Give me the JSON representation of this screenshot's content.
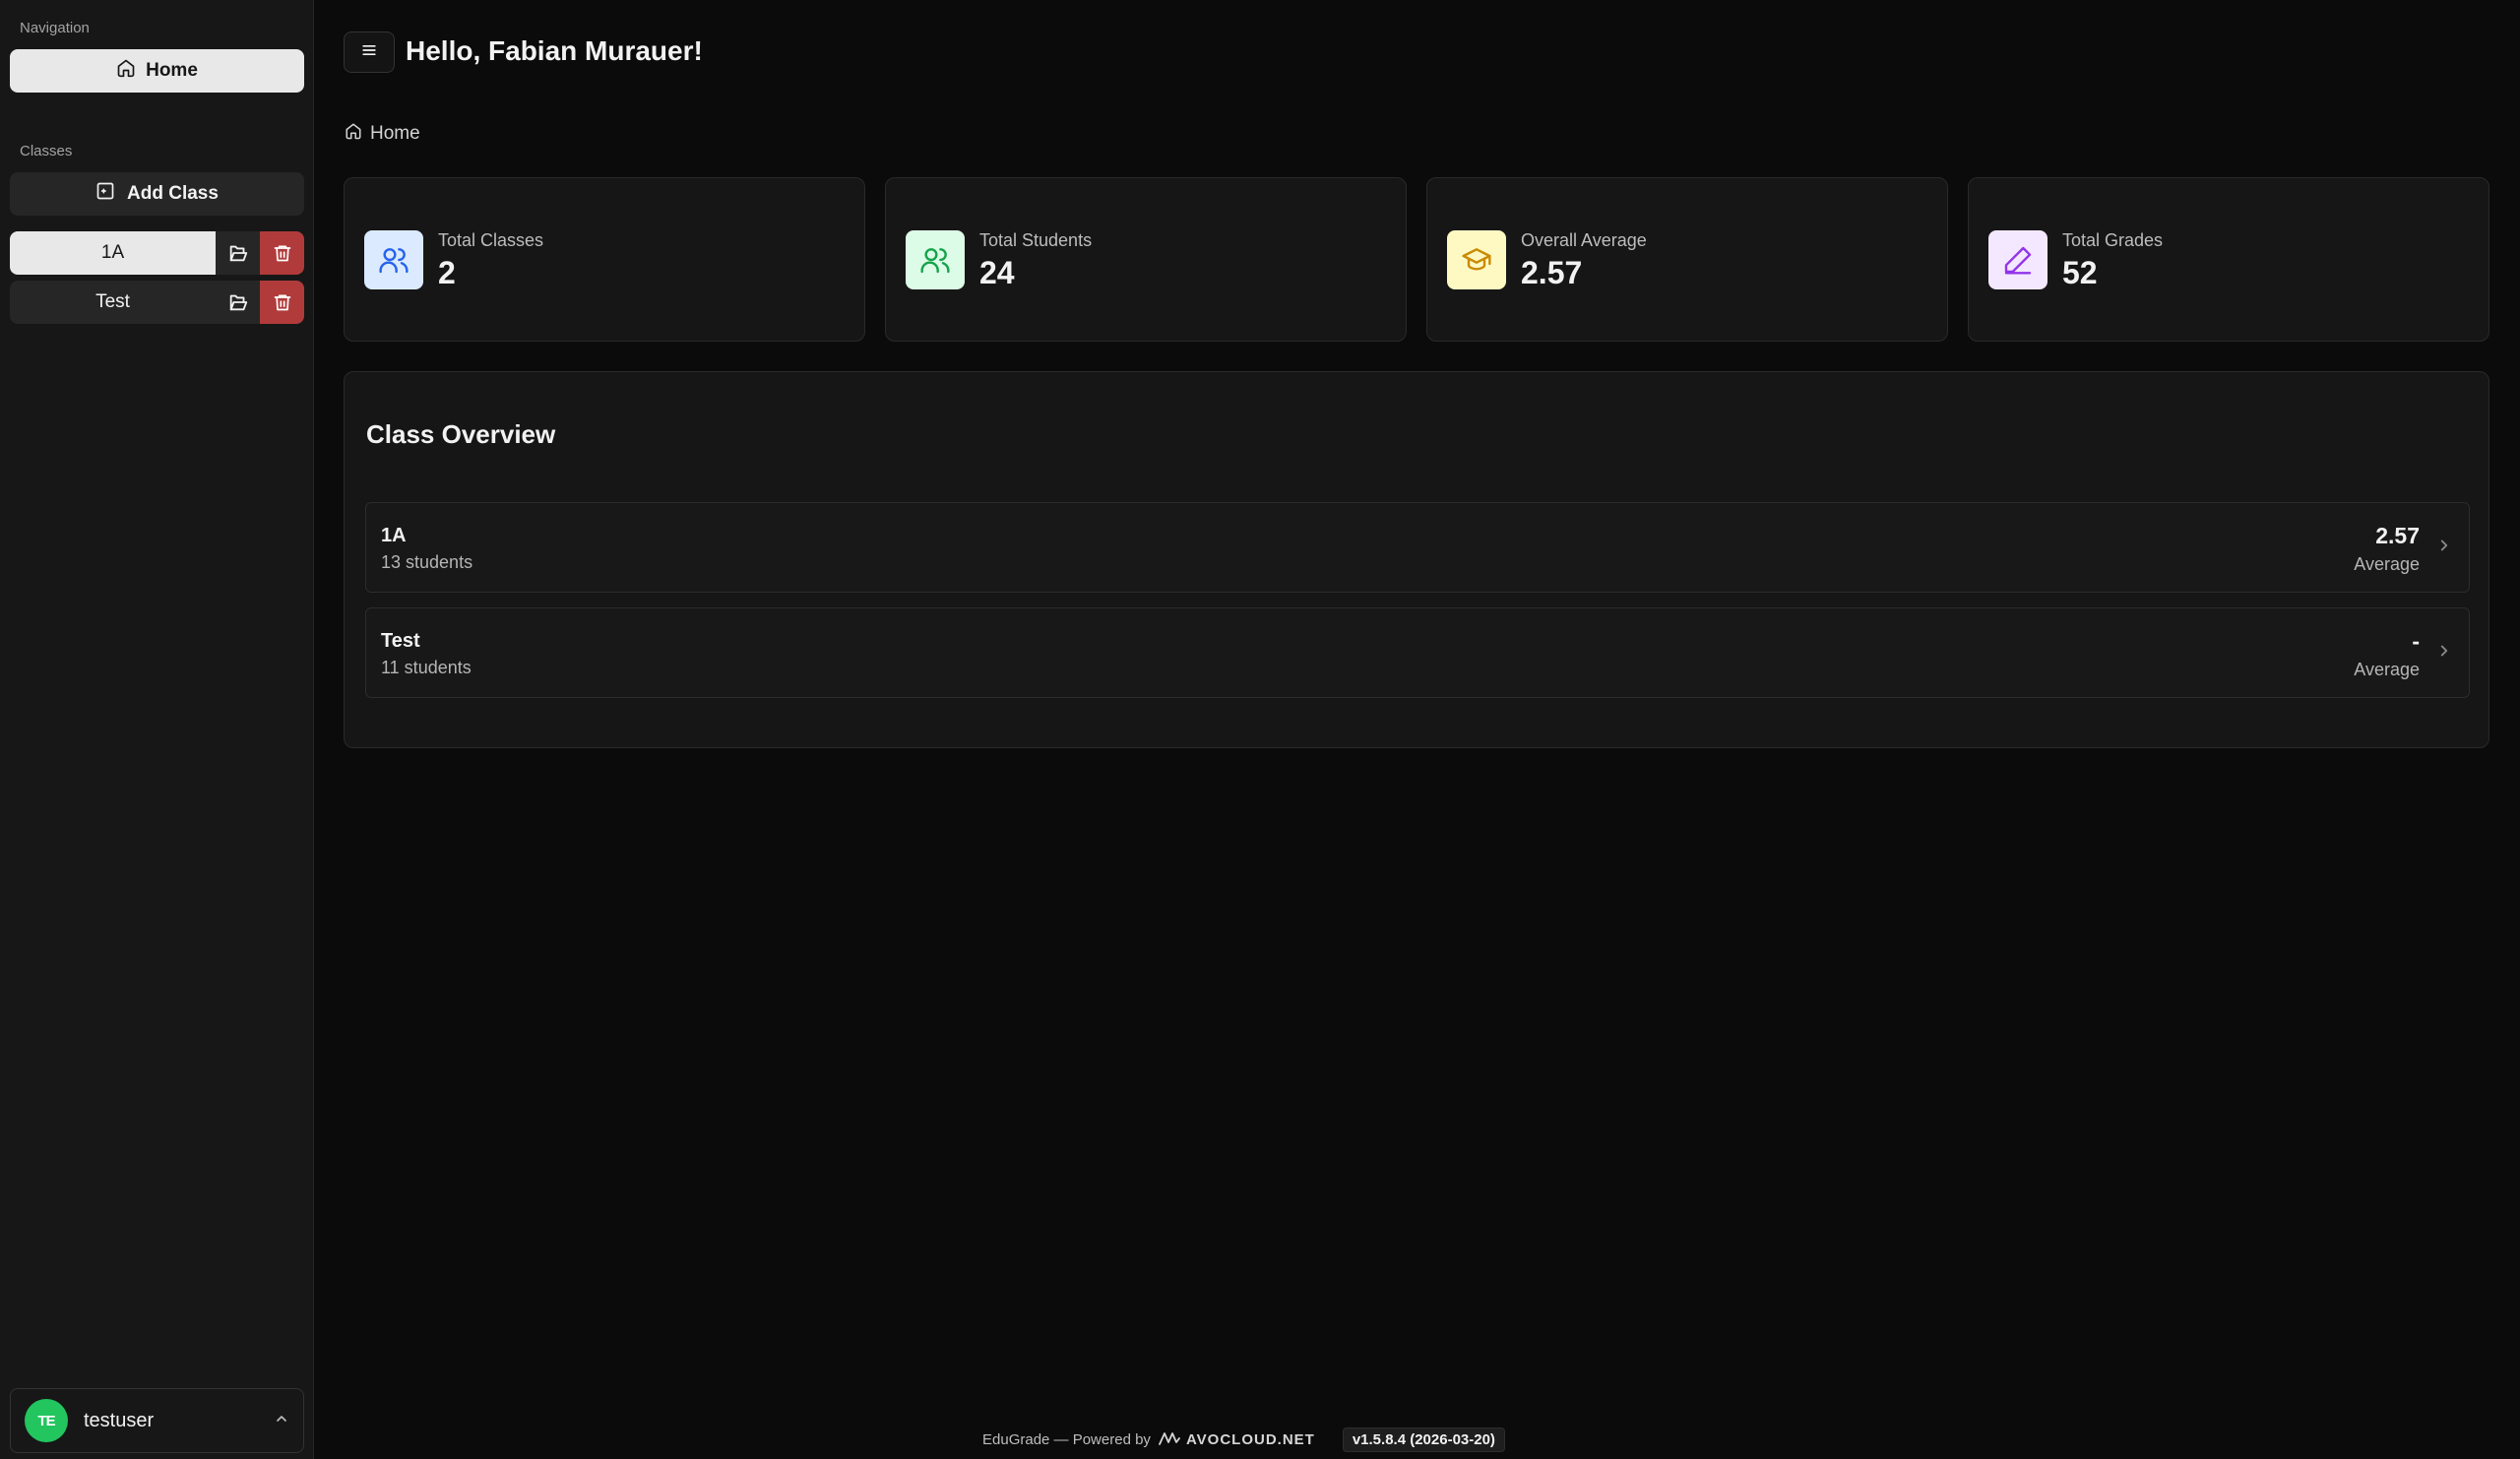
{
  "sidebar": {
    "navigation_label": "Navigation",
    "home_label": "Home",
    "classes_label": "Classes",
    "add_class_label": "Add Class",
    "classes": [
      {
        "name": "1A",
        "active": true
      },
      {
        "name": "Test",
        "active": false
      }
    ],
    "user": {
      "initials": "TE",
      "name": "testuser"
    }
  },
  "header": {
    "greeting": "Hello, Fabian Murauer!"
  },
  "breadcrumb": {
    "label": "Home"
  },
  "stats": [
    {
      "label": "Total Classes",
      "value": "2",
      "icon": "users-icon",
      "color": "#2563eb",
      "bg": "#dbeafe"
    },
    {
      "label": "Total Students",
      "value": "24",
      "icon": "users-icon",
      "color": "#16a34a",
      "bg": "#dcfce7"
    },
    {
      "label": "Overall Average",
      "value": "2.57",
      "icon": "graduation-cap-icon",
      "color": "#ca8a04",
      "bg": "#fef9c3"
    },
    {
      "label": "Total Grades",
      "value": "52",
      "icon": "pencil-icon",
      "color": "#9333ea",
      "bg": "#f3e8ff"
    }
  ],
  "overview": {
    "title": "Class Overview",
    "rows": [
      {
        "name": "1A",
        "students": "13 students",
        "average": "2.57",
        "average_label": "Average"
      },
      {
        "name": "Test",
        "students": "11 students",
        "average": "-",
        "average_label": "Average"
      }
    ]
  },
  "footer": {
    "text": "EduGrade — Powered by",
    "brand": "AVOCLOUD.NET",
    "version": "v1.5.8.4 (2026-03-20)"
  }
}
